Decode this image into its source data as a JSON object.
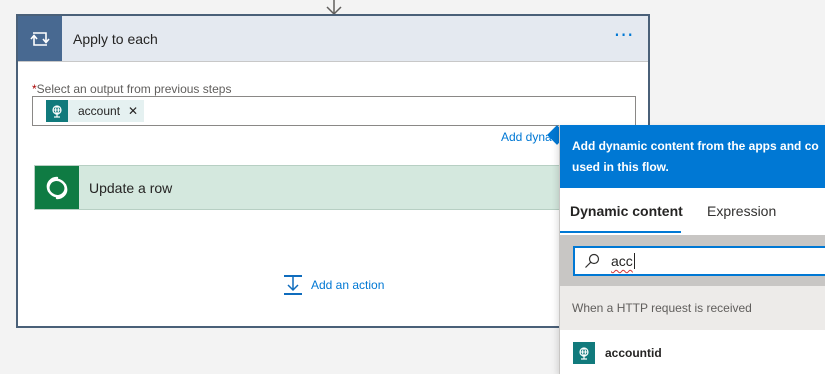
{
  "apply_to_each": {
    "title": "Apply to each",
    "more_label": "⋯",
    "field": {
      "required_marker": "*",
      "label": "Select an output from previous steps",
      "token": {
        "label": "account",
        "remove_glyph": "✕",
        "icon": "http-request-icon"
      }
    },
    "add_dynamic_label": "Add dyna",
    "inner_action": {
      "title": "Update a row",
      "icon": "dataverse-icon"
    },
    "add_action_label": "Add an action"
  },
  "dynamic_panel": {
    "header_line1": "Add dynamic content from the apps and co",
    "header_line2": "used in this flow.",
    "tabs": [
      {
        "label": "Dynamic content",
        "active": true
      },
      {
        "label": "Expression",
        "active": false
      }
    ],
    "search": {
      "value": "acc"
    },
    "section_title": "When a HTTP request is received",
    "results": [
      {
        "label": "accountid",
        "icon": "http-request-icon"
      }
    ]
  },
  "colors": {
    "accent": "#0078d4",
    "loop_icon_bg": "#486991",
    "http_icon_bg": "#117a7c",
    "dataverse_bg": "#0f7b43",
    "update_row_bg": "#d4e8de"
  }
}
